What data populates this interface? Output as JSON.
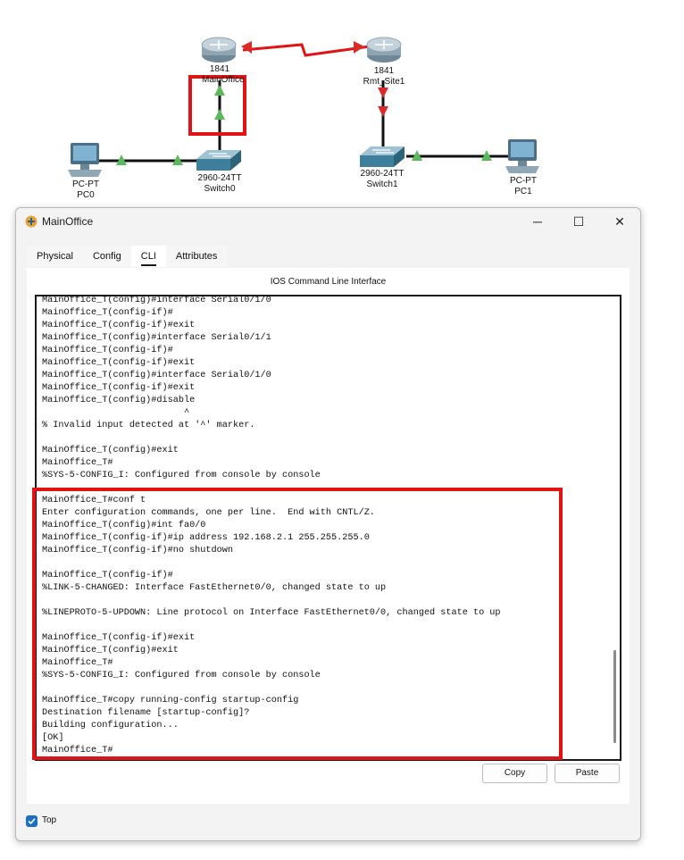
{
  "topology": {
    "devices": [
      {
        "id": "mainoffice",
        "type": "router",
        "label_top": "1841",
        "label_bottom": "MainOffice",
        "icon": "router-icon"
      },
      {
        "id": "rmtsite1",
        "type": "router",
        "label_top": "1841",
        "label_bottom": "Rmt_Site1",
        "icon": "router-icon"
      },
      {
        "id": "switch0",
        "type": "switch",
        "label_top": "2960-24TT",
        "label_bottom": "Switch0",
        "icon": "switch-icon"
      },
      {
        "id": "switch1",
        "type": "switch",
        "label_top": "2960-24TT",
        "label_bottom": "Switch1",
        "icon": "switch-icon"
      },
      {
        "id": "pc0",
        "type": "pc",
        "label_top": "PC-PT",
        "label_bottom": "PC0",
        "icon": "pc-icon"
      },
      {
        "id": "pc1",
        "type": "pc",
        "label_top": "PC-PT",
        "label_bottom": "PC1",
        "icon": "pc-icon"
      }
    ],
    "link_up_color": "#5cb85c",
    "link_down_color": "#d92b2b",
    "serial_link_color": "#e01414",
    "highlight_color": "#e01414"
  },
  "window": {
    "title": "MainOffice",
    "controls": {
      "minimize": "─",
      "maximize": "☐",
      "close": "✕"
    },
    "tabs": [
      "Physical",
      "Config",
      "CLI",
      "Attributes"
    ],
    "active_tab": "CLI",
    "panel_title": "IOS Command Line Interface",
    "terminal_lines": [
      "MainOffice_T(config)#interface Serial0/1/0",
      "MainOffice_T(config-if)#",
      "MainOffice_T(config-if)#exit",
      "MainOffice_T(config)#interface Serial0/1/1",
      "MainOffice_T(config-if)#",
      "MainOffice_T(config-if)#exit",
      "MainOffice_T(config)#interface Serial0/1/0",
      "MainOffice_T(config-if)#exit",
      "MainOffice_T(config)#disable",
      "                          ^",
      "% Invalid input detected at '^' marker.",
      "",
      "MainOffice_T(config)#exit",
      "MainOffice_T#",
      "%SYS-5-CONFIG_I: Configured from console by console",
      "",
      "MainOffice_T#conf t",
      "Enter configuration commands, one per line.  End with CNTL/Z.",
      "MainOffice_T(config)#int fa0/0",
      "MainOffice_T(config-if)#ip address 192.168.2.1 255.255.255.0",
      "MainOffice_T(config-if)#no shutdown",
      "",
      "MainOffice_T(config-if)#",
      "%LINK-5-CHANGED: Interface FastEthernet0/0, changed state to up",
      "",
      "%LINEPROTO-5-UPDOWN: Line protocol on Interface FastEthernet0/0, changed state to up",
      "",
      "MainOffice_T(config-if)#exit",
      "MainOffice_T(config)#exit",
      "MainOffice_T#",
      "%SYS-5-CONFIG_I: Configured from console by console",
      "",
      "MainOffice_T#copy running-config startup-config",
      "Destination filename [startup-config]?",
      "Building configuration...",
      "[OK]",
      "MainOffice_T#"
    ],
    "copy_label": "Copy",
    "paste_label": "Paste",
    "top_checkbox": {
      "label": "Top",
      "checked": true
    }
  }
}
